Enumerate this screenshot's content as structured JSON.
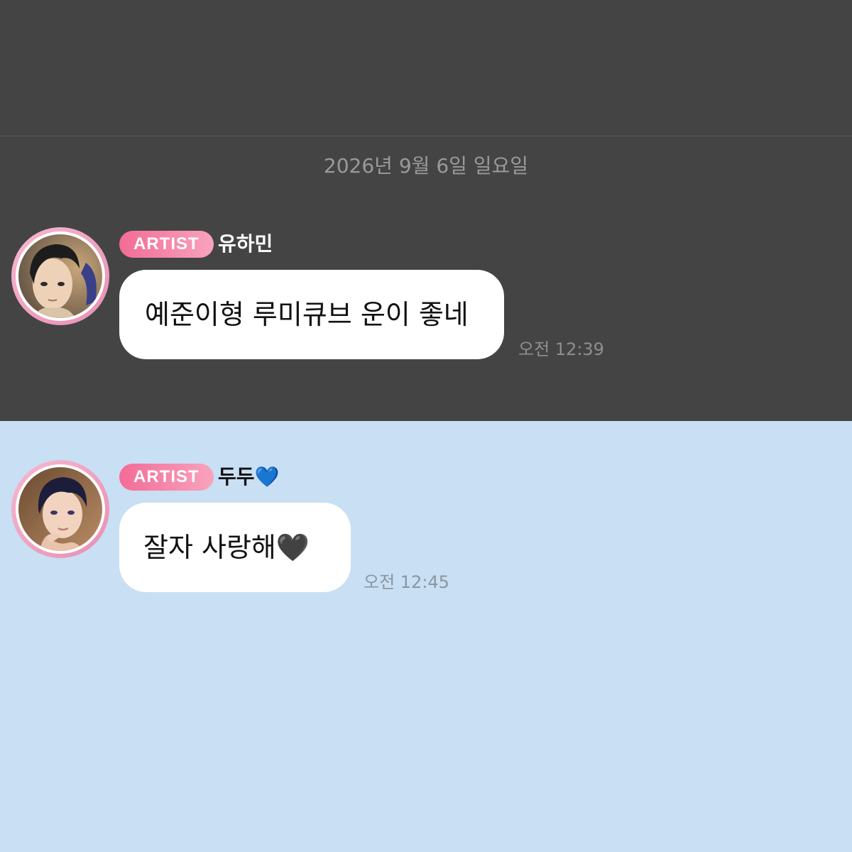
{
  "date_separator": "2026년 9월 6일 일요일",
  "messages": [
    {
      "badge": "ARTIST",
      "sender": "유하민",
      "text": "예준이형 루미큐브 운이 좋네",
      "time": "오전 12:39",
      "avatar_icon": "illustrated-portrait-avatar"
    },
    {
      "badge": "ARTIST",
      "sender": "두두",
      "sender_emoji": "💙",
      "text": "잘자 사랑해",
      "text_emoji": "🖤",
      "time": "오전 12:45",
      "avatar_icon": "illustrated-portrait-avatar"
    }
  ],
  "colors": {
    "dark_panel": "#444444",
    "light_panel": "#c9dff3",
    "badge_gradient_start": "#f36c96",
    "badge_gradient_end": "#f8a3bd",
    "avatar_ring": "#f0a8c6",
    "bubble": "#ffffff"
  }
}
